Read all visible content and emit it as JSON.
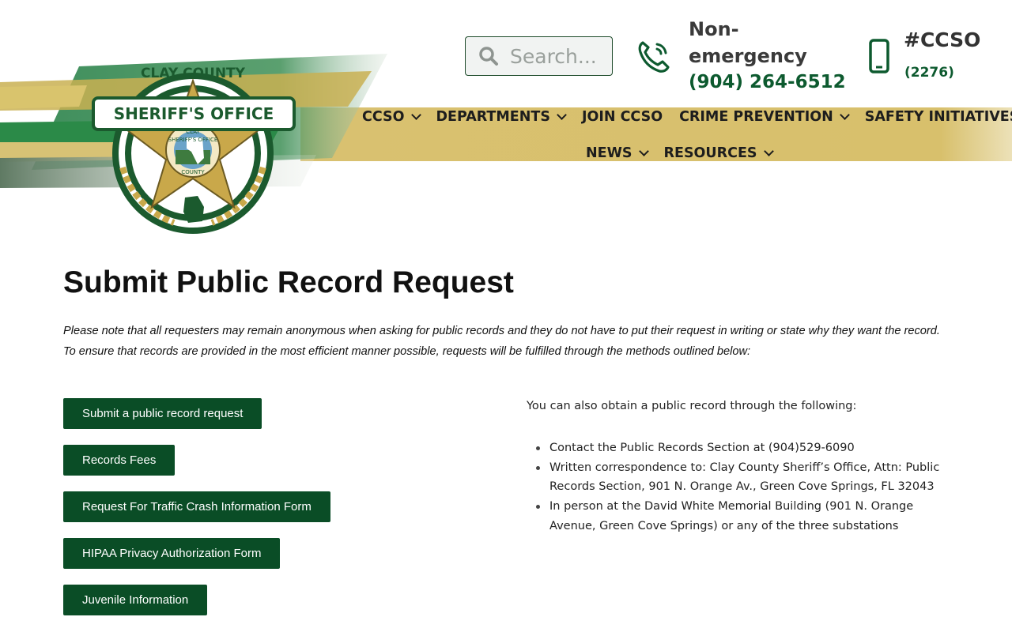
{
  "header": {
    "search": {
      "placeholder": "Search..."
    },
    "non_emergency": {
      "label": "Non-emergency",
      "number": "(904) 264-6512"
    },
    "mobile": {
      "tag": "#CCSO",
      "number": "(2276)"
    },
    "logo": {
      "text_top": "CLAY COUNTY",
      "text_banner": "SHERIFF'S OFFICE",
      "seal_text_top": "SHERIFF'S OFFICE",
      "seal_text_mid": "CLAY",
      "seal_text_bottom": "COUNTY"
    }
  },
  "nav": {
    "row1": [
      {
        "label": "CCSO",
        "has_dropdown": true
      },
      {
        "label": "DEPARTMENTS",
        "has_dropdown": true
      },
      {
        "label": "JOIN CCSO",
        "has_dropdown": false
      },
      {
        "label": "CRIME PREVENTION",
        "has_dropdown": true
      },
      {
        "label": "SAFETY INITIATIVES",
        "has_dropdown": true
      }
    ],
    "row2": [
      {
        "label": "NEWS",
        "has_dropdown": true
      },
      {
        "label": "RESOURCES",
        "has_dropdown": true
      }
    ]
  },
  "main": {
    "title": "Submit Public Record Request",
    "intro": "Please note that all requesters may remain anonymous when asking for public records and they do not have to put their request in writing or state why they want the record. To ensure that records are provided in the most efficient manner possible, requests will be fulfilled through the methods outlined below:",
    "buttons": [
      "Submit a public record request",
      "Records Fees",
      "Request For Traffic Crash Information Form",
      "HIPAA Privacy Authorization Form",
      "Juvenile Information"
    ],
    "also_text": "You can also obtain a public record through the following:",
    "alternatives": [
      "Contact the Public Records Section at (904)529-6090",
      "Written correspondence to: Clay County Sheriff’s Office, Attn: Public Records Section, 901 N. Orange Av., Green Cove Springs, FL 32043",
      "In person at the David White Memorial Building (901 N. Orange Avenue, Green Cove Springs) or any of the three substations"
    ]
  },
  "colors": {
    "brand_green": "#0a4d26",
    "accent_green": "#0d5a2f",
    "gold": "#d8bf6a"
  }
}
